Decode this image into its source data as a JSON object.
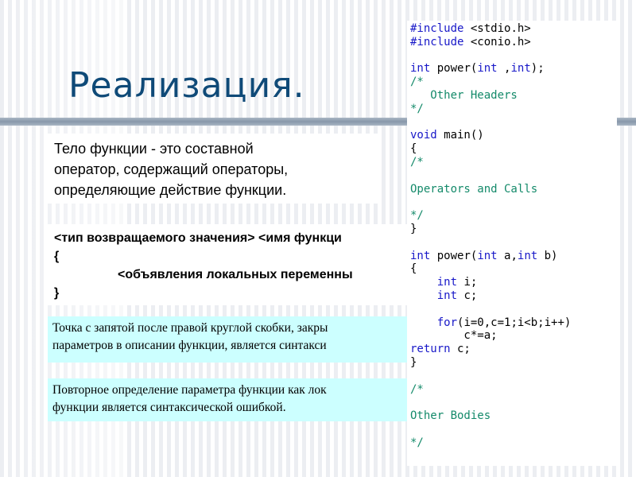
{
  "slide": {
    "title": "Реализация."
  },
  "body_text": {
    "line1": "Тело функции - это составной",
    "line2": "оператор, содержащий операторы,",
    "line3": "определяющие действие функции."
  },
  "syntax": {
    "line1": "<тип возвращаемого значения> <имя функци",
    "line2": "{",
    "line3": "<объявления локальных переменны",
    "line4": "}"
  },
  "note1": {
    "line1": "Точка с запятой после правой круглой скобки, закры",
    "line2": "параметров в описании функции, является синтакси"
  },
  "note2": {
    "line1": "Повторное определение параметра функции как лок",
    "line2": "функции является синтаксической ошибкой."
  },
  "code": {
    "l1a": "#include",
    "l1b": " <stdio.h>",
    "l2a": "#include",
    "l2b": " <conio.h>",
    "l4a": "int",
    "l4b": " power(",
    "l4c": "int",
    "l4d": " ,",
    "l4e": "int",
    "l4f": ");",
    "l5": "/*",
    "l6": "   Other Headers",
    "l7": "*/",
    "l9a": "void",
    "l9b": " main()",
    "l10": "{",
    "l11": "/*",
    "l13": "Operators and Calls",
    "l15": "*/",
    "l16": "}",
    "l18a": "int",
    "l18b": " power(",
    "l18c": "int",
    "l18d": " a,",
    "l18e": "int",
    "l18f": " b)",
    "l19": "{",
    "l20a": "    int",
    "l20b": " i;",
    "l21a": "    int",
    "l21b": " c;",
    "l23a": "    for",
    "l23b": "(i=0,c=1;i<b;i++)",
    "l24": "        c*=a;",
    "l25a": "return",
    "l25b": " c;",
    "l26": "}",
    "l28": "/*",
    "l30": "Other Bodies",
    "l32": "*/"
  }
}
